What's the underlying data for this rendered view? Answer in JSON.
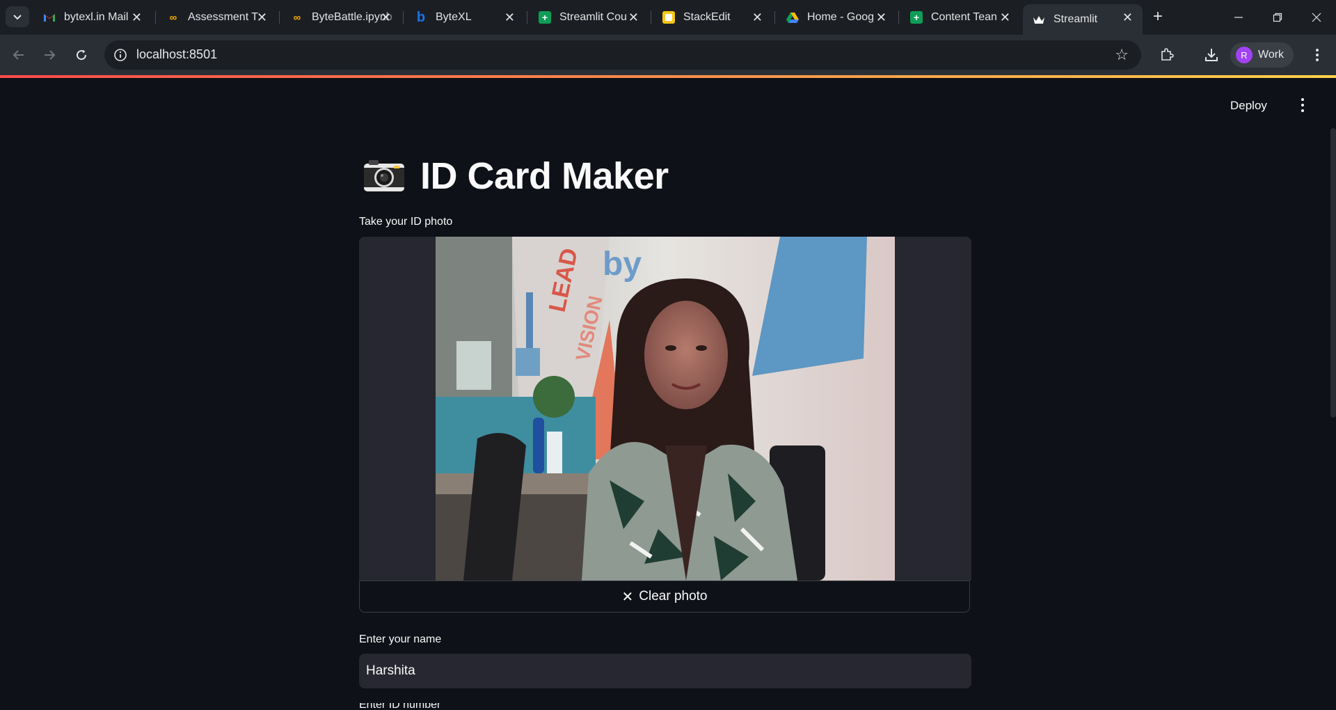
{
  "browser": {
    "tabs": [
      {
        "title": "bytexl.in Mail",
        "icon": "gmail-icon"
      },
      {
        "title": "Assessment T",
        "icon": "colab-icon"
      },
      {
        "title": "ByteBattle.ipynb",
        "icon": "colab-icon"
      },
      {
        "title": "ByteXL",
        "icon": "bytexl-icon"
      },
      {
        "title": "Streamlit Cou",
        "icon": "sheets-icon"
      },
      {
        "title": "StackEdit",
        "icon": "stackedit-icon"
      },
      {
        "title": "Home - Goog",
        "icon": "drive-icon"
      },
      {
        "title": "Content Tean",
        "icon": "sheets-icon"
      },
      {
        "title": "Streamlit",
        "icon": "streamlit-icon",
        "active": true
      }
    ],
    "url": "localhost:8501",
    "profile": {
      "initial": "R",
      "label": "Work"
    }
  },
  "app": {
    "deploy_label": "Deploy",
    "title_emoji": "camera-icon",
    "title": "ID Card Maker",
    "camera_label": "Take your ID photo",
    "clear_button": "Clear photo",
    "name_label": "Enter your name",
    "name_value": "Harshita",
    "next_label": "Enter ID number"
  },
  "colors": {
    "background": "#0e1117",
    "input_bg": "#262730",
    "accent_gradient": [
      "#ff4b4b",
      "#ffd24b"
    ]
  }
}
